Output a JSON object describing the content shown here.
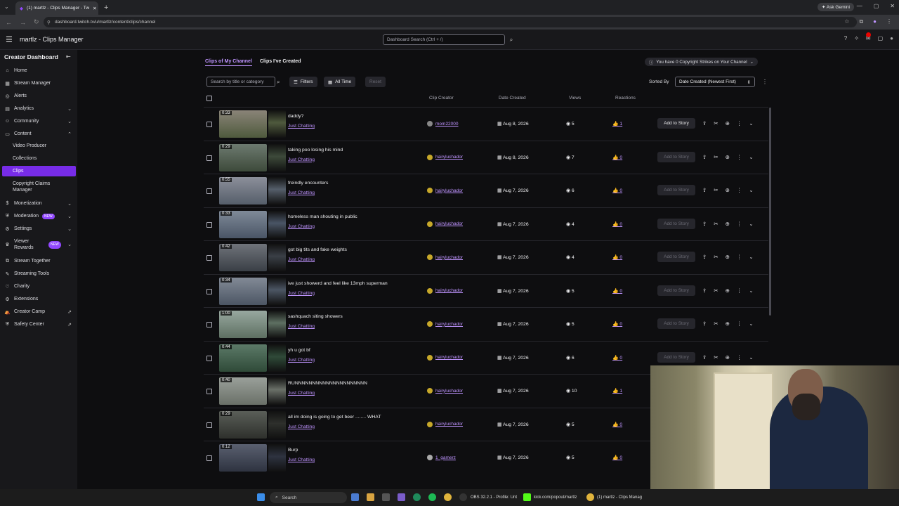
{
  "browser": {
    "tab_title": "(1) martlz - Clips Manager - Tw",
    "url": "dashboard.twitch.tv/u/martlz/content/clips/channel",
    "gemini": "Ask Gemini"
  },
  "topnav": {
    "title": "martlz - Clips Manager",
    "search_placeholder": "Dashboard Search (Ctrl + /)"
  },
  "sidebar": {
    "heading": "Creator Dashboard",
    "items": [
      {
        "label": "Home"
      },
      {
        "label": "Stream Manager"
      },
      {
        "label": "Alerts"
      },
      {
        "label": "Analytics"
      },
      {
        "label": "Community"
      },
      {
        "label": "Content"
      },
      {
        "label": "Video Producer"
      },
      {
        "label": "Collections"
      },
      {
        "label": "Clips"
      },
      {
        "label": "Copyright Claims Manager"
      },
      {
        "label": "Monetization"
      },
      {
        "label": "Moderation"
      },
      {
        "label": "Settings"
      },
      {
        "label": "Viewer Rewards"
      },
      {
        "label": "Stream Together"
      },
      {
        "label": "Streaming Tools"
      },
      {
        "label": "Charity"
      },
      {
        "label": "Extensions"
      },
      {
        "label": "Creator Camp"
      },
      {
        "label": "Safety Center"
      }
    ],
    "new_badge": "NEW"
  },
  "main": {
    "tabs": [
      "Clips of My Channel",
      "Clips I've Created"
    ],
    "strikes": "You have 0 Copyright Strikes on Your Channel",
    "search_placeholder": "Search by title or category",
    "filters": "Filters",
    "all_time": "All Time",
    "reset": "Reset",
    "sorted_by": "Sorted By",
    "sort_value": "Date Created (Newest First)",
    "columns": {
      "creator": "Clip Creator",
      "date": "Date Created",
      "views": "Views",
      "reactions": "Reactions"
    },
    "add_to_story": "Add to Story",
    "clips": [
      {
        "duration": "0:33",
        "title": "daddy?",
        "category": "Just Chatting",
        "creator": "mom22000",
        "date": "Aug 8, 2026",
        "views": "5",
        "reactions": "1"
      },
      {
        "duration": "0:29",
        "title": "taking poo losing his mind",
        "category": "Just Chatting",
        "creator": "hairyluchador",
        "date": "Aug 8, 2026",
        "views": "7",
        "reactions": "0"
      },
      {
        "duration": "0:55",
        "title": "freindly encounters",
        "category": "Just Chatting",
        "creator": "hairyluchador",
        "date": "Aug 7, 2026",
        "views": "6",
        "reactions": "0"
      },
      {
        "duration": "0:33",
        "title": "homeless man shouting in public",
        "category": "Just Chatting",
        "creator": "hairyluchador",
        "date": "Aug 7, 2026",
        "views": "4",
        "reactions": "0"
      },
      {
        "duration": "0:42",
        "title": "got big tits and fake weights",
        "category": "Just Chatting",
        "creator": "hairyluchador",
        "date": "Aug 7, 2026",
        "views": "4",
        "reactions": "0"
      },
      {
        "duration": "0:34",
        "title": "ive just showerd and feel like 13mph superman",
        "category": "Just Chatting",
        "creator": "hairyluchador",
        "date": "Aug 7, 2026",
        "views": "5",
        "reactions": "0"
      },
      {
        "duration": "1:00",
        "title": "sashquach siting showers",
        "category": "Just Chatting",
        "creator": "hairyluchador",
        "date": "Aug 7, 2026",
        "views": "5",
        "reactions": "0"
      },
      {
        "duration": "0:44",
        "title": "yh u got bf",
        "category": "Just Chatting",
        "creator": "hairyluchador",
        "date": "Aug 7, 2026",
        "views": "6",
        "reactions": "0"
      },
      {
        "duration": "0:40",
        "title": "RUNNNNNNNNNNNNNNNNNNNNN",
        "category": "Just Chatting",
        "creator": "hairyluchador",
        "date": "Aug 7, 2026",
        "views": "10",
        "reactions": "1"
      },
      {
        "duration": "0:29",
        "title": "all im doing is going to get beer ........ WHAT",
        "category": "Just Chatting",
        "creator": "hairyluchador",
        "date": "Aug 7, 2026",
        "views": "5",
        "reactions": "0"
      },
      {
        "duration": "0:12",
        "title": "Burp",
        "category": "Just Chatting",
        "creator": "1_gamerz",
        "date": "Aug 7, 2026",
        "views": "5",
        "reactions": "0"
      }
    ]
  },
  "taskbar": {
    "search": "Search",
    "obs": "OBS 32.2.1 - Profile: Unt",
    "kick": "kick.com/popout/martlz",
    "chrome": "(1) martlz - Clips Manag"
  },
  "colors": {
    "accent": "#9147ff",
    "link": "#bf94ff",
    "active_nav": "#772ce8"
  }
}
